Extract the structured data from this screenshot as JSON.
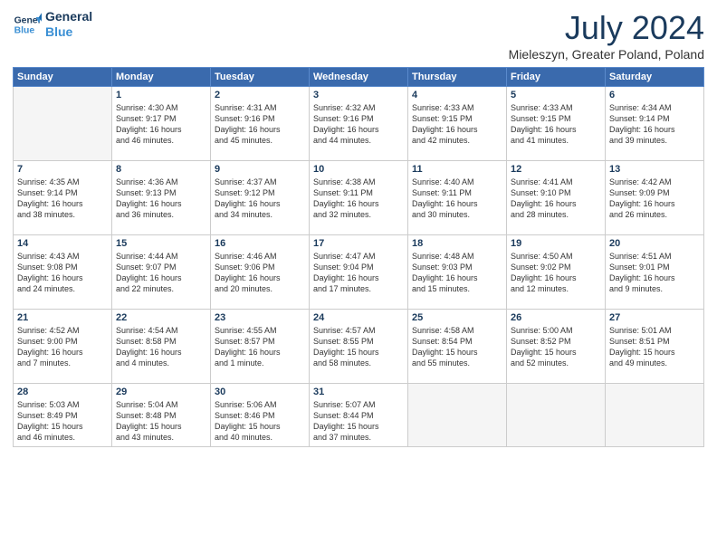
{
  "logo": {
    "line1": "General",
    "line2": "Blue"
  },
  "title": "July 2024",
  "location": "Mieleszyn, Greater Poland, Poland",
  "days_of_week": [
    "Sunday",
    "Monday",
    "Tuesday",
    "Wednesday",
    "Thursday",
    "Friday",
    "Saturday"
  ],
  "weeks": [
    [
      {
        "num": "",
        "info": ""
      },
      {
        "num": "1",
        "info": "Sunrise: 4:30 AM\nSunset: 9:17 PM\nDaylight: 16 hours\nand 46 minutes."
      },
      {
        "num": "2",
        "info": "Sunrise: 4:31 AM\nSunset: 9:16 PM\nDaylight: 16 hours\nand 45 minutes."
      },
      {
        "num": "3",
        "info": "Sunrise: 4:32 AM\nSunset: 9:16 PM\nDaylight: 16 hours\nand 44 minutes."
      },
      {
        "num": "4",
        "info": "Sunrise: 4:33 AM\nSunset: 9:15 PM\nDaylight: 16 hours\nand 42 minutes."
      },
      {
        "num": "5",
        "info": "Sunrise: 4:33 AM\nSunset: 9:15 PM\nDaylight: 16 hours\nand 41 minutes."
      },
      {
        "num": "6",
        "info": "Sunrise: 4:34 AM\nSunset: 9:14 PM\nDaylight: 16 hours\nand 39 minutes."
      }
    ],
    [
      {
        "num": "7",
        "info": "Sunrise: 4:35 AM\nSunset: 9:14 PM\nDaylight: 16 hours\nand 38 minutes."
      },
      {
        "num": "8",
        "info": "Sunrise: 4:36 AM\nSunset: 9:13 PM\nDaylight: 16 hours\nand 36 minutes."
      },
      {
        "num": "9",
        "info": "Sunrise: 4:37 AM\nSunset: 9:12 PM\nDaylight: 16 hours\nand 34 minutes."
      },
      {
        "num": "10",
        "info": "Sunrise: 4:38 AM\nSunset: 9:11 PM\nDaylight: 16 hours\nand 32 minutes."
      },
      {
        "num": "11",
        "info": "Sunrise: 4:40 AM\nSunset: 9:11 PM\nDaylight: 16 hours\nand 30 minutes."
      },
      {
        "num": "12",
        "info": "Sunrise: 4:41 AM\nSunset: 9:10 PM\nDaylight: 16 hours\nand 28 minutes."
      },
      {
        "num": "13",
        "info": "Sunrise: 4:42 AM\nSunset: 9:09 PM\nDaylight: 16 hours\nand 26 minutes."
      }
    ],
    [
      {
        "num": "14",
        "info": "Sunrise: 4:43 AM\nSunset: 9:08 PM\nDaylight: 16 hours\nand 24 minutes."
      },
      {
        "num": "15",
        "info": "Sunrise: 4:44 AM\nSunset: 9:07 PM\nDaylight: 16 hours\nand 22 minutes."
      },
      {
        "num": "16",
        "info": "Sunrise: 4:46 AM\nSunset: 9:06 PM\nDaylight: 16 hours\nand 20 minutes."
      },
      {
        "num": "17",
        "info": "Sunrise: 4:47 AM\nSunset: 9:04 PM\nDaylight: 16 hours\nand 17 minutes."
      },
      {
        "num": "18",
        "info": "Sunrise: 4:48 AM\nSunset: 9:03 PM\nDaylight: 16 hours\nand 15 minutes."
      },
      {
        "num": "19",
        "info": "Sunrise: 4:50 AM\nSunset: 9:02 PM\nDaylight: 16 hours\nand 12 minutes."
      },
      {
        "num": "20",
        "info": "Sunrise: 4:51 AM\nSunset: 9:01 PM\nDaylight: 16 hours\nand 9 minutes."
      }
    ],
    [
      {
        "num": "21",
        "info": "Sunrise: 4:52 AM\nSunset: 9:00 PM\nDaylight: 16 hours\nand 7 minutes."
      },
      {
        "num": "22",
        "info": "Sunrise: 4:54 AM\nSunset: 8:58 PM\nDaylight: 16 hours\nand 4 minutes."
      },
      {
        "num": "23",
        "info": "Sunrise: 4:55 AM\nSunset: 8:57 PM\nDaylight: 16 hours\nand 1 minute."
      },
      {
        "num": "24",
        "info": "Sunrise: 4:57 AM\nSunset: 8:55 PM\nDaylight: 15 hours\nand 58 minutes."
      },
      {
        "num": "25",
        "info": "Sunrise: 4:58 AM\nSunset: 8:54 PM\nDaylight: 15 hours\nand 55 minutes."
      },
      {
        "num": "26",
        "info": "Sunrise: 5:00 AM\nSunset: 8:52 PM\nDaylight: 15 hours\nand 52 minutes."
      },
      {
        "num": "27",
        "info": "Sunrise: 5:01 AM\nSunset: 8:51 PM\nDaylight: 15 hours\nand 49 minutes."
      }
    ],
    [
      {
        "num": "28",
        "info": "Sunrise: 5:03 AM\nSunset: 8:49 PM\nDaylight: 15 hours\nand 46 minutes."
      },
      {
        "num": "29",
        "info": "Sunrise: 5:04 AM\nSunset: 8:48 PM\nDaylight: 15 hours\nand 43 minutes."
      },
      {
        "num": "30",
        "info": "Sunrise: 5:06 AM\nSunset: 8:46 PM\nDaylight: 15 hours\nand 40 minutes."
      },
      {
        "num": "31",
        "info": "Sunrise: 5:07 AM\nSunset: 8:44 PM\nDaylight: 15 hours\nand 37 minutes."
      },
      {
        "num": "",
        "info": ""
      },
      {
        "num": "",
        "info": ""
      },
      {
        "num": "",
        "info": ""
      }
    ]
  ]
}
